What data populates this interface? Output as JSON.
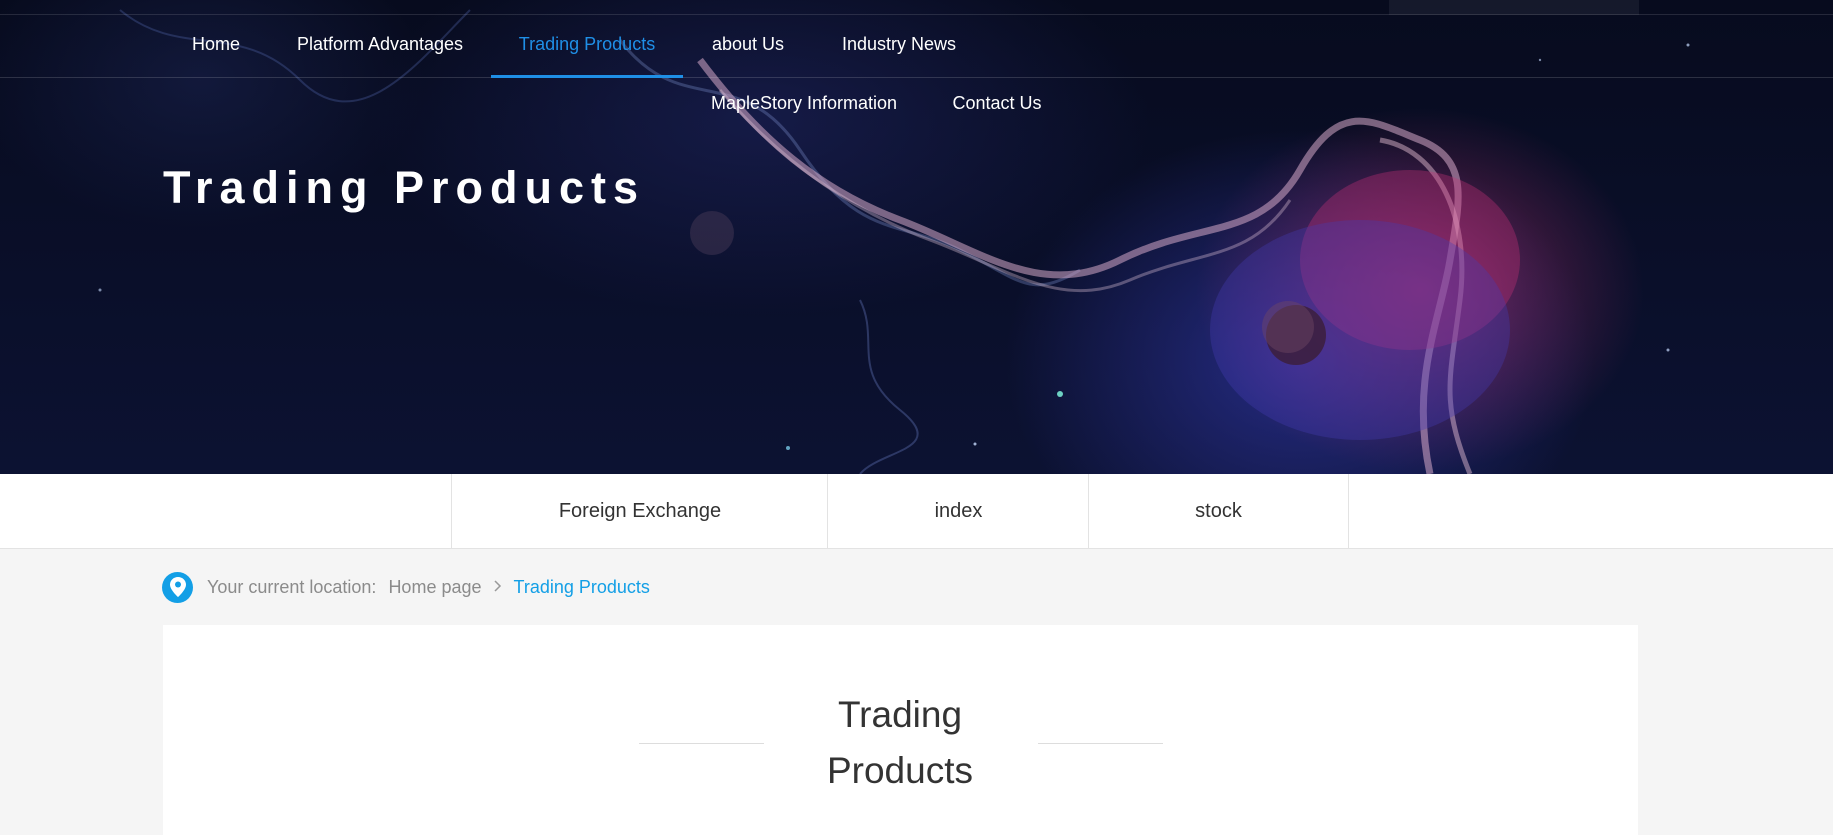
{
  "nav": {
    "items": [
      {
        "label": "Home"
      },
      {
        "label": "Platform Advantages"
      },
      {
        "label": "Trading Products",
        "active": true
      },
      {
        "label": "about Us"
      },
      {
        "label": "Industry News"
      },
      {
        "label": "MapleStory Information"
      },
      {
        "label": "Contact Us"
      }
    ]
  },
  "hero": {
    "title": "Trading Products"
  },
  "subtabs": [
    {
      "label": "Foreign Exchange"
    },
    {
      "label": "index"
    },
    {
      "label": "stock"
    }
  ],
  "breadcrumb": {
    "prefix": "Your current location:",
    "home": "Home page",
    "separator": ">",
    "current": "Trading Products"
  },
  "section": {
    "title": "Trading Products"
  },
  "colors": {
    "accent": "#139fe6",
    "nav_active": "#1f8fe6",
    "hero_bg": "#070b1e",
    "page_bg": "#f5f5f5"
  },
  "icons": {
    "breadcrumb": "location-pin-icon"
  }
}
